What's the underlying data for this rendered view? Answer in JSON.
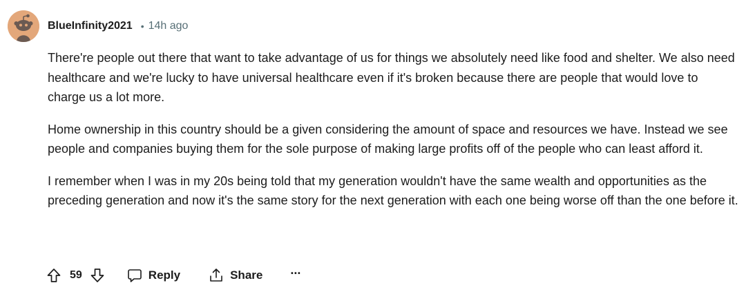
{
  "comment": {
    "avatar_icon": "snoo-avatar-icon",
    "avatar_color": "#e3a77a",
    "username": "BlueInfinity2021",
    "separator": "•",
    "timestamp": "14h ago",
    "paragraphs": [
      "There're people out there that want to take advantage of us for things we absolutely need like food and shelter. We also need healthcare and we're lucky to have universal healthcare even if it's broken because there are people that would love to charge us a lot more.",
      "Home ownership in this country should be a given considering the amount of space and resources we have. Instead we see people and companies buying them for the sole purpose of making large profits off of the people who can least afford it.",
      "I remember when I was in my 20s being told that my generation wouldn't have the same wealth and opportunities as the preceding generation and now it's the same story for the next generation with each one being worse off than the one before it."
    ]
  },
  "actions": {
    "upvote_icon": "upvote-arrow-icon",
    "downvote_icon": "downvote-arrow-icon",
    "score": "59",
    "reply_icon": "speech-bubble-icon",
    "reply_label": "Reply",
    "share_icon": "share-icon",
    "share_label": "Share",
    "more_label": "···"
  }
}
